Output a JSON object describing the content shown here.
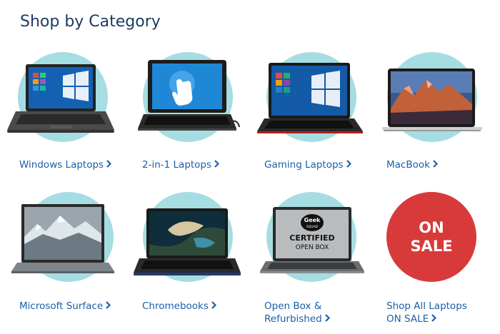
{
  "section_title": "Shop by Category",
  "categories": [
    {
      "label": "Windows Laptops",
      "icon": "chevron-right-icon"
    },
    {
      "label": "2-in-1 Laptops",
      "icon": "chevron-right-icon"
    },
    {
      "label": "Gaming Laptops",
      "icon": "chevron-right-icon"
    },
    {
      "label": "MacBook",
      "icon": "chevron-right-icon"
    },
    {
      "label": "Microsoft Surface",
      "icon": "chevron-right-icon"
    },
    {
      "label": "Chromebooks",
      "icon": "chevron-right-icon"
    },
    {
      "label_line1": "Open Box &",
      "label_line2": "Refurbished",
      "icon": "chevron-right-icon"
    },
    {
      "label_line1": "Shop All Laptops",
      "label_line2": "ON SALE",
      "icon": "chevron-right-icon"
    }
  ],
  "badges": {
    "geek_squad_line1": "Geek",
    "geek_squad_line2": "SQUAD",
    "certified": "CERTIFIED",
    "open_box": "OPEN BOX",
    "sale_line1": "ON",
    "sale_line2": "SALE"
  },
  "colors": {
    "circle": "#a6dde3",
    "link": "#1b5fa8",
    "title": "#1d3a5f",
    "sale": "#d83a3a"
  }
}
